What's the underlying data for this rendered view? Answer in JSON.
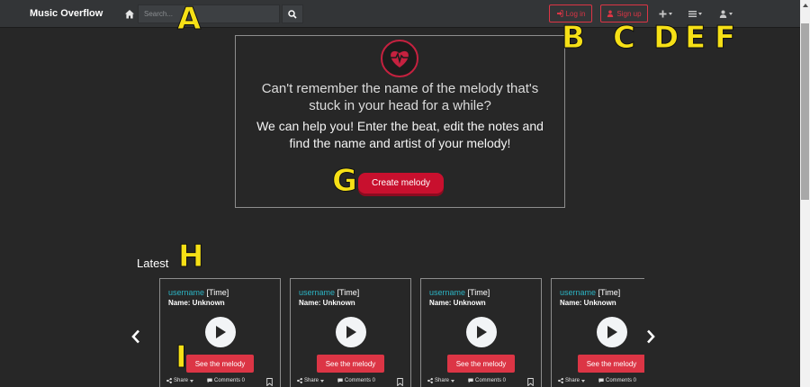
{
  "navbar": {
    "brand": "Music Overflow",
    "search_placeholder": "Search...",
    "login_label": "Log in",
    "signup_label": "Sign up"
  },
  "hero": {
    "title": "Can't remember the name of the melody that's stuck in your head for a while?",
    "subtitle": "We can help you! Enter the beat, edit the notes and find the name and artist of your melody!",
    "create_label": "Create melody"
  },
  "latest": {
    "title": "Latest",
    "cards": [
      {
        "username": "username",
        "time": "[Time]",
        "name": "Name: Unknown",
        "see_label": "See the melody",
        "share_label": "Share",
        "comments_label": "Comments 0"
      },
      {
        "username": "username",
        "time": "[Time]",
        "name": "Name: Unknown",
        "see_label": "See the melody",
        "share_label": "Share",
        "comments_label": "Comments 0"
      },
      {
        "username": "username",
        "time": "[Time]",
        "name": "Name: Unknown",
        "see_label": "See the melody",
        "share_label": "Share",
        "comments_label": "Comments 0"
      },
      {
        "username": "username",
        "time": "[Time]",
        "name": "Name: Unknown",
        "see_label": "See the melody",
        "share_label": "Share",
        "comments_label": "Comments 0"
      }
    ]
  },
  "markers": [
    "A",
    "B",
    "C",
    "D",
    "E",
    "F",
    "G",
    "H",
    "I"
  ],
  "icons": {
    "home": "home-icon",
    "search": "search-icon",
    "login": "sign-in-icon",
    "signup": "user-icon",
    "add": "plus-icon",
    "menu": "bars-icon",
    "account": "user-icon",
    "logo": "heartbeat-icon",
    "play": "play-icon",
    "prev": "chevron-left-icon",
    "next": "chevron-right-icon",
    "share": "share-icon",
    "comments": "comment-icon",
    "bookmark": "bookmark-icon"
  },
  "colors": {
    "background": "#272727",
    "navbar": "#333537",
    "accent_red": "#dc3545",
    "create_red": "#c8102e",
    "username_teal": "#2bb4c4",
    "marker_yellow": "#f6e016"
  }
}
